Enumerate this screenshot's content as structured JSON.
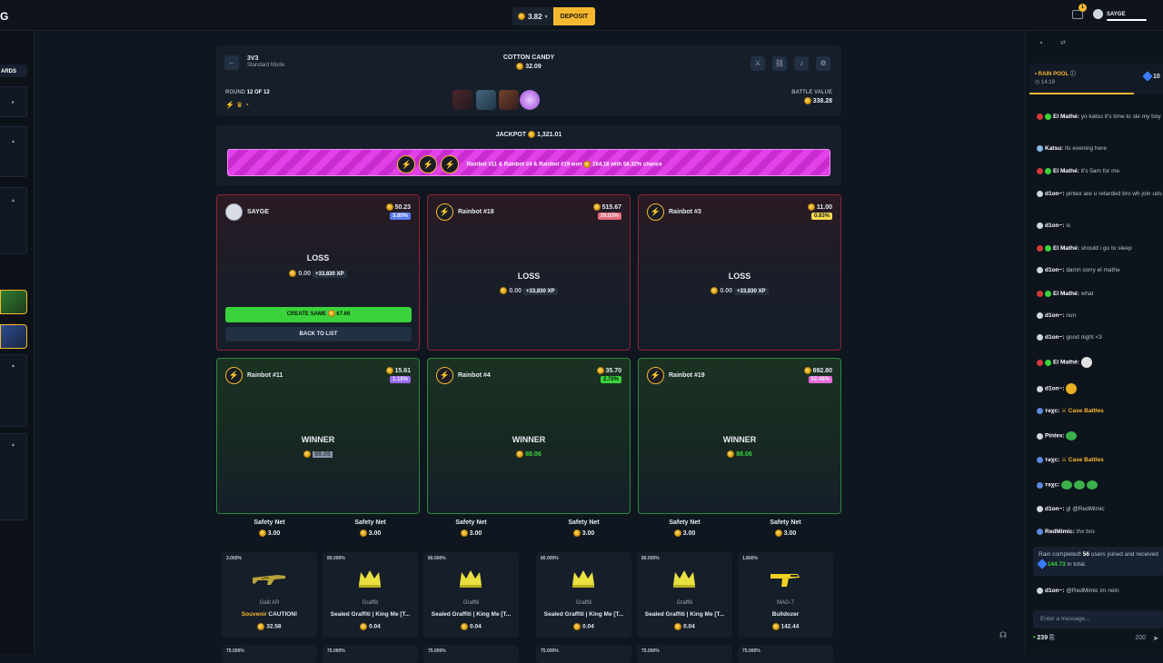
{
  "topbar": {
    "logo": "G",
    "balance": "3.82",
    "deposit_label": "DEPOSIT",
    "notif_count": "1",
    "username": "SAYGE"
  },
  "leftnav": {
    "leaderboards_label": "ARDS"
  },
  "battle": {
    "mode_title": "3V3",
    "mode_sub": "Standard Mode",
    "case_name": "COTTON CANDY",
    "case_price": "32.09",
    "round_label": "ROUND",
    "round_value": "12 OF 12",
    "value_label": "BATTLE VALUE",
    "value": "338.28"
  },
  "jackpot": {
    "label": "JACKPOT",
    "amount": "1,321.01",
    "summary": "Rainbot #11 & Rainbot #4 & Rainbot #19 won",
    "won_amount": "264.18",
    "chance": "with 58.32% chance"
  },
  "players": [
    {
      "name": "SAYGE",
      "value": "50.23",
      "pct": "3.80%",
      "result": "LOSS",
      "amount": "0.00",
      "xp": "+33,830 XP"
    },
    {
      "name": "Rainbot #18",
      "value": "515.67",
      "pct": "39.03%",
      "result": "LOSS",
      "amount": "0.00",
      "xp": "+33,830 XP"
    },
    {
      "name": "Rainbot #3",
      "value": "11.00",
      "pct": "0.83%",
      "result": "LOSS",
      "amount": "0.00",
      "xp": "+33,830 XP"
    },
    {
      "name": "Rainbot #11",
      "value": "15.61",
      "pct": "1.18%",
      "result": "WINNER",
      "amount": "88.06"
    },
    {
      "name": "Rainbot #4",
      "value": "35.70",
      "pct": "2.70%",
      "result": "WINNER",
      "amount": "88.06"
    },
    {
      "name": "Rainbot #19",
      "value": "692.80",
      "pct": "52.46%",
      "result": "WINNER",
      "amount": "88.06"
    }
  ],
  "buttons": {
    "create_same": "CREATE SAME",
    "create_same_price": "67.66",
    "back_to_list": "BACK TO LIST"
  },
  "items": [
    {
      "head": "Safety Net",
      "head_price": "3.00",
      "pct": "3.000%",
      "type": "Galil AR",
      "name_prefix": "Souvenir",
      "name": "CAUTION!",
      "price": "32.58",
      "pct2": "75.000%"
    },
    {
      "head": "Safety Net",
      "head_price": "3.00",
      "pct": "80.000%",
      "type": "Graffiti",
      "name": "Sealed Graffiti | King Me [T...",
      "price": "0.04",
      "pct2": "75.000%"
    },
    {
      "head": "Safety Net",
      "head_price": "3.00",
      "pct": "80.000%",
      "type": "Graffiti",
      "name": "Sealed Graffiti | King Me [T...",
      "price": "0.04",
      "pct2": "75.000%"
    },
    {
      "head": "Safety Net",
      "head_price": "3.00",
      "pct": "80.000%",
      "type": "Graffiti",
      "name": "Sealed Graffiti | King Me [T...",
      "price": "0.04",
      "pct2": "75.000%"
    },
    {
      "head": "Safety Net",
      "head_price": "3.00",
      "pct": "80.000%",
      "type": "Graffiti",
      "name": "Sealed Graffiti | King Me [T...",
      "price": "0.04",
      "pct2": "75.000%"
    },
    {
      "head": "Safety Net",
      "head_price": "3.00",
      "pct": "1.800%",
      "type": "MAG-7",
      "name": "Bulldozer",
      "price": "142.44",
      "pct2": "75.000%"
    }
  ],
  "chat": {
    "rain_title": "RAIN POOL",
    "rain_timer": "14:19",
    "rain_amount": "10",
    "messages": [
      {
        "user": "El Mathé:",
        "text": "yo katsu it's time to sle my boy"
      },
      {
        "user": "Katsu:",
        "text": "its evening here"
      },
      {
        "user": "El Mathé:",
        "text": "it's 5am for me"
      },
      {
        "user": "d1on~:",
        "text": "pintex are u retarded bro wh join uds"
      },
      {
        "user": "d1on~:",
        "text": "is"
      },
      {
        "user": "El Mathé:",
        "text": "should i go to sleep"
      },
      {
        "user": "d1on~:",
        "text": "damn sorry el mathe"
      },
      {
        "user": "El Mathé:",
        "text": "what"
      },
      {
        "user": "d1on~:",
        "text": "nun"
      },
      {
        "user": "d1on~:",
        "text": "good night <3"
      },
      {
        "user": "El Mathé:",
        "text": ""
      },
      {
        "user": "d1on~:",
        "text": ""
      },
      {
        "user": "тәχс:",
        "text": "Case Battles"
      },
      {
        "user": "Pintex:",
        "text": ""
      },
      {
        "user": "тәχс:",
        "text": "Case Battles"
      },
      {
        "user": "тәχс:",
        "text": ""
      },
      {
        "user": "d1on~:",
        "text": "gl",
        "mention": "@RedMimic"
      },
      {
        "user": "RedMimic:",
        "text": "thx bro"
      },
      {
        "user": "d1on~:",
        "text": "im nein",
        "mention": "@RedMimic"
      }
    ],
    "rain_done_1": "Rain completed!",
    "rain_done_users": "56",
    "rain_done_2": "users joined and received",
    "rain_done_amount": "144.73",
    "rain_done_3": "in total.",
    "input_placeholder": "Enter a message...",
    "online": "239",
    "char_limit": "200"
  }
}
